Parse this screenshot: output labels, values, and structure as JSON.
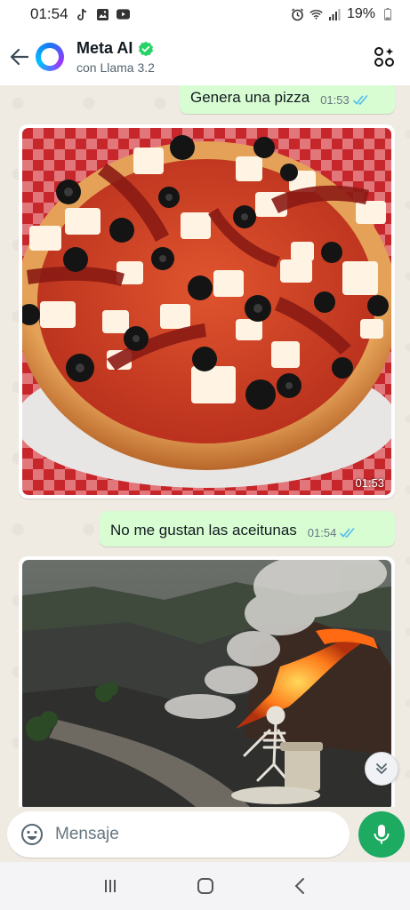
{
  "status_bar": {
    "time": "01:54",
    "battery": "19%"
  },
  "header": {
    "name": "Meta AI",
    "subtitle": "con Llama 3.2",
    "back_icon": "arrow-left-icon",
    "action_icon": "grid-sparkle-icon"
  },
  "messages": [
    {
      "type": "text",
      "direction": "outgoing",
      "text": "Genera una pizza",
      "time": "01:53",
      "status": "read"
    },
    {
      "type": "image",
      "direction": "incoming",
      "subject": "pizza",
      "time": "01:53"
    },
    {
      "type": "text",
      "direction": "outgoing",
      "text": "No me gustan las aceitunas",
      "time": "01:54",
      "status": "read"
    },
    {
      "type": "image",
      "direction": "incoming",
      "subject": "volcano"
    }
  ],
  "input": {
    "placeholder": "Mensaje"
  },
  "colors": {
    "outgoing_bubble": "#d9fdd3",
    "chat_background": "#efeae2",
    "mic_button": "#1daa61",
    "read_ticks": "#53bdeb",
    "verified_badge": "#25d366"
  }
}
